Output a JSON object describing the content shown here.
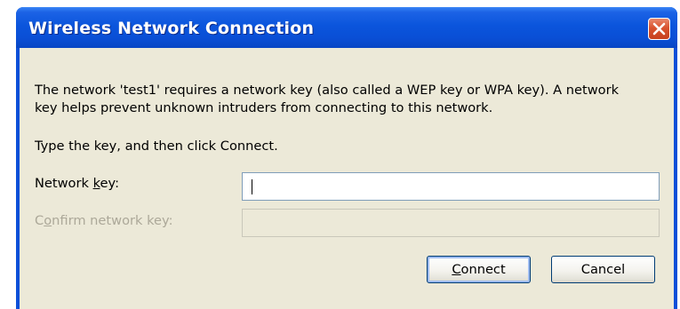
{
  "window": {
    "title": "Wireless Network Connection"
  },
  "message": {
    "line1": "The network 'test1' requires a network key (also called a WEP key or WPA key). A network",
    "line2": "key helps prevent unknown intruders from connecting to this network."
  },
  "instruction": "Type the key, and then click Connect.",
  "fields": {
    "network_key_label_prefix": "Network ",
    "network_key_label_accel": "k",
    "network_key_label_suffix": "ey:",
    "network_key_value": "",
    "confirm_label_prefix": "C",
    "confirm_label_accel": "o",
    "confirm_label_suffix": "nfirm network key:",
    "confirm_value": ""
  },
  "buttons": {
    "connect_accel": "C",
    "connect_rest": "onnect",
    "cancel_label": "Cancel"
  },
  "colors": {
    "titlebar": "#0a4fd6",
    "client": "#ece9d8",
    "close": "#d9532f",
    "disabled_text": "#aca899"
  }
}
